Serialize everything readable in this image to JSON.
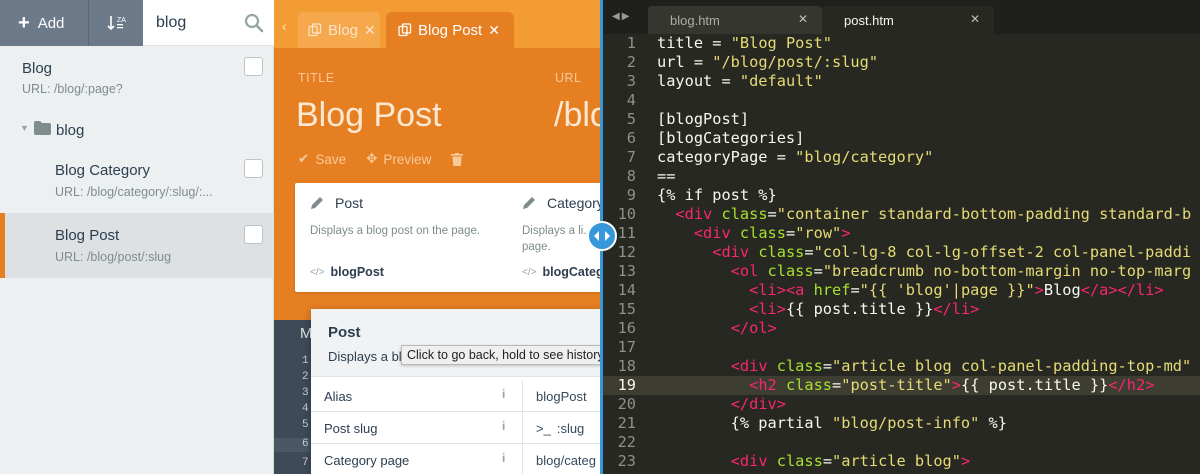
{
  "sidebar": {
    "add_label": "Add",
    "sort_icon_label": "ZA",
    "search_value": "blog",
    "items": [
      {
        "title": "Blog",
        "url": "URL: /blog/:page?"
      },
      {
        "folder": "blog"
      },
      {
        "title": "Blog Category",
        "url": "URL: /blog/category/:slug/:..."
      },
      {
        "title": "Blog Post",
        "url": "URL: /blog/post/:slug"
      }
    ]
  },
  "middle": {
    "tabs": [
      {
        "label": "Blog"
      },
      {
        "label": "Blog Post"
      }
    ],
    "title_label": "TITLE",
    "title_value": "Blog Post",
    "url_label": "URL",
    "url_value": "/blo",
    "save_label": "Save",
    "preview_label": "Preview",
    "components": [
      {
        "title": "Post",
        "desc": "Displays a blog post on the page.",
        "alias": "blogPost"
      },
      {
        "title": "Category",
        "desc": "Displays a li... page.",
        "alias": "blogCateg"
      }
    ],
    "m_label": "M",
    "gutter": [
      "1",
      "2",
      "3",
      "4",
      "5",
      "6",
      "7"
    ],
    "popover": {
      "title": "Post",
      "desc": "Displays a bl",
      "rows": [
        {
          "name": "Alias",
          "value": "blogPost"
        },
        {
          "name": "Post slug",
          "value": ":slug"
        },
        {
          "name": "Category page",
          "value": "blog/categ"
        }
      ]
    },
    "tooltip": "Click to go back, hold to see history"
  },
  "editor": {
    "tabs": [
      {
        "label": "blog.htm"
      },
      {
        "label": "post.htm"
      }
    ],
    "current_line": 19,
    "lines": [
      "title = \"Blog Post\"",
      "url = \"/blog/post/:slug\"",
      "layout = \"default\"",
      "",
      "[blogPost]",
      "[blogCategories]",
      "categoryPage = \"blog/category\"",
      "==",
      "{% if post %}",
      "  <div class=\"container standard-bottom-padding standard-b",
      "    <div class=\"row\">",
      "      <div class=\"col-lg-8 col-lg-offset-2 col-panel-paddi",
      "        <ol class=\"breadcrumb no-bottom-margin no-top-marg",
      "          <li><a href=\"{{ 'blog'|page }}\">Blog</a></li>",
      "          <li>{{ post.title }}</li>",
      "        </ol>",
      "",
      "        <div class=\"article blog col-panel-padding-top-md\"",
      "          <h2 class=\"post-title\">{{ post.title }}</h2>",
      "        </div>",
      "        {% partial \"blog/post-info\" %}",
      "",
      "        <div class=\"article blog\">"
    ]
  },
  "colors": {
    "accent_orange": "#e67e22",
    "accent_blue": "#3498db",
    "editor_bg": "#272822"
  }
}
